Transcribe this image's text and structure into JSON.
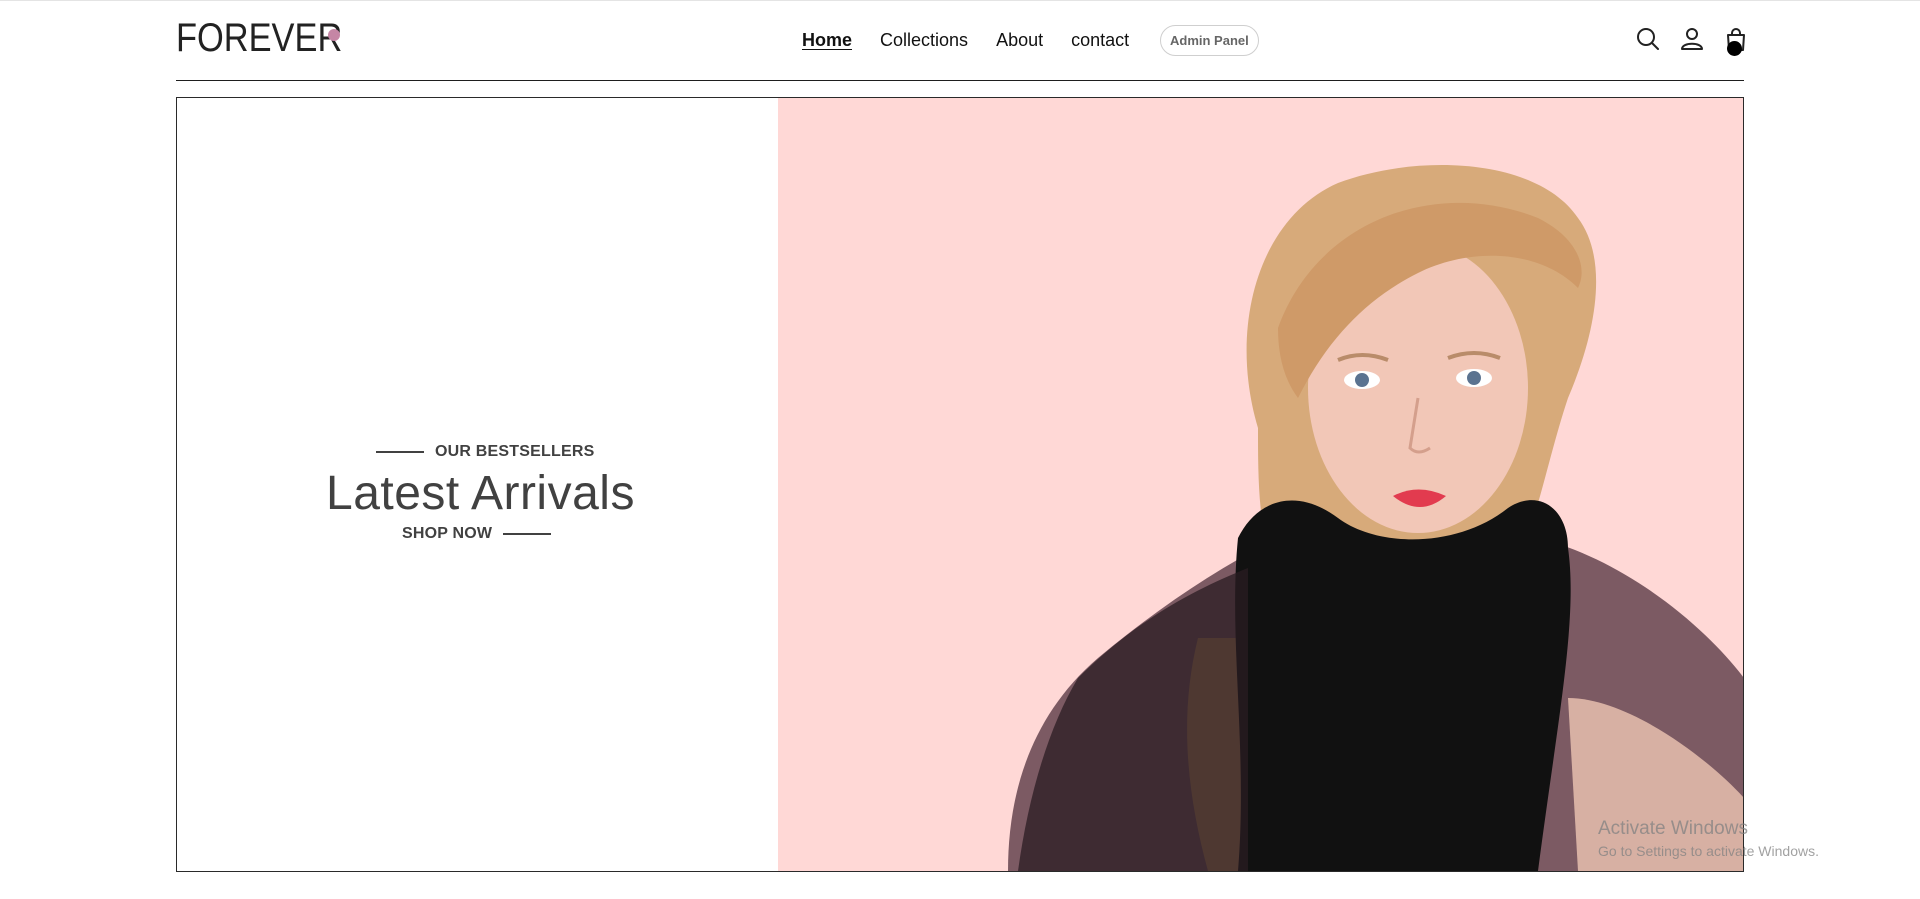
{
  "brand": {
    "logo_text": "FOREVER",
    "dot_color": "#c586a5"
  },
  "nav": {
    "links": [
      {
        "label": "Home",
        "active": true
      },
      {
        "label": "Collections",
        "active": false
      },
      {
        "label": "About",
        "active": false
      },
      {
        "label": "contact",
        "active": false
      }
    ],
    "admin_label": "Admin Panel"
  },
  "header_icons": {
    "search": "search-icon",
    "profile": "user-icon",
    "cart": "shopping-bag-icon"
  },
  "hero": {
    "eyebrow": "OUR BESTSELLERS",
    "title": "Latest Arrivals",
    "cta": "SHOP NOW",
    "image_bg_color": "#ffd8d6",
    "image_alt": "hero-model-photo"
  },
  "watermark": {
    "title": "Activate Windows",
    "subtitle": "Go to Settings to activate Windows."
  }
}
